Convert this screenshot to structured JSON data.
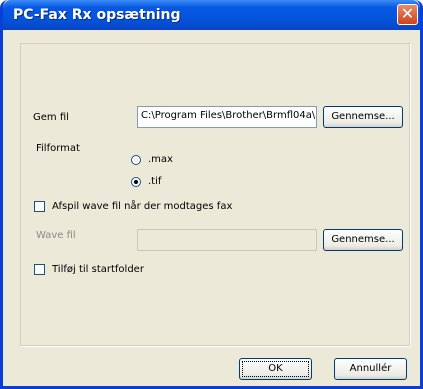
{
  "window": {
    "title": "PC-Fax Rx opsætning",
    "close_glyph": "✕"
  },
  "save_file": {
    "label": "Gem fil",
    "path": "C:\\Program Files\\Brother\\Brmfl04a\\",
    "browse_label": "Gennemse..."
  },
  "file_format": {
    "label": "Filformat",
    "options": [
      ".max",
      ".tif"
    ],
    "selected": ".tif"
  },
  "play_wave": {
    "label": "Afspil wave fil når der modtages fax",
    "checked": false
  },
  "wave_file": {
    "label": "Wave fil",
    "value": "",
    "browse_label": "Gennemse..."
  },
  "startup_folder": {
    "label": "Tilføj til startfolder",
    "checked": false
  },
  "buttons": {
    "ok": "OK",
    "cancel": "Annullér"
  }
}
